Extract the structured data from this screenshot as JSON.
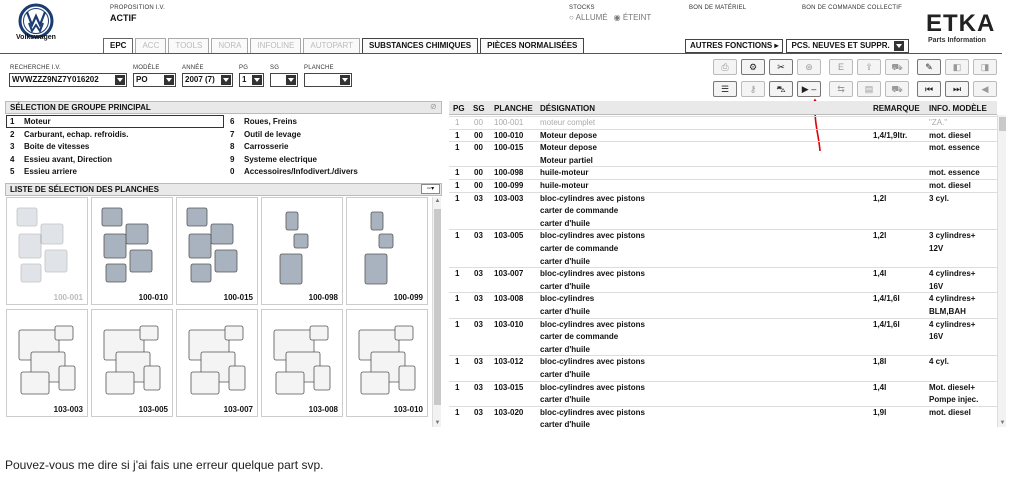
{
  "header": {
    "brand": "Volkswagen",
    "proposition_label": "PROPOSITION I.V.",
    "proposition_value": "ACTIF",
    "stocks_label": "STOCKS",
    "stocks_on": "ALLUMÉ",
    "stocks_off": "ÉTEINT",
    "stocks_selected": "ÉTEINT",
    "bom_label": "BON DE MATÉRIEL",
    "order_label": "BON DE COMMANDE COLLECTIF",
    "product": "ETKA",
    "product_sub": "Parts Information"
  },
  "tabs": [
    "EPC",
    "ACC",
    "TOOLS",
    "NORA",
    "INFOLINE",
    "AUTOPART",
    "SUBSTANCES CHIMIQUES",
    "PIÈCES NORMALISÉES"
  ],
  "active_tab": "EPC",
  "other_functions": {
    "label": "AUTRES FONCTIONS",
    "value": "PCS. NEUVES ET SUPPR."
  },
  "search": {
    "vin_label": "RECHERCHE I.V.",
    "vin_value": "WVWZZZ9NZ7Y016202",
    "model_label": "MODÈLE",
    "model_value": "PO",
    "year_label": "ANNÉE",
    "year_value": "2007 (7)",
    "pg_label": "PG",
    "pg_value": "1",
    "sg_label": "SG",
    "sg_value": "",
    "plate_label": "PLANCHE",
    "plate_value": ""
  },
  "group_panel": {
    "title": "SÉLECTION DE GROUPE PRINCIPAL",
    "groups": [
      {
        "num": "1",
        "label": "Moteur"
      },
      {
        "num": "2",
        "label": "Carburant, echap. refroidis."
      },
      {
        "num": "3",
        "label": "Boite de vitesses"
      },
      {
        "num": "4",
        "label": "Essieu avant, Direction"
      },
      {
        "num": "5",
        "label": "Essieu arriere"
      },
      {
        "num": "6",
        "label": "Roues, Freins"
      },
      {
        "num": "7",
        "label": "Outil de levage"
      },
      {
        "num": "8",
        "label": "Carrosserie"
      },
      {
        "num": "9",
        "label": "Systeme electrique"
      },
      {
        "num": "0",
        "label": "Accessoires/Infodivert./divers"
      }
    ],
    "selected": "1"
  },
  "plates_panel": {
    "title": "LISTE DE SÉLECTION DES PLANCHES",
    "plates": [
      "100-001",
      "100-010",
      "100-015",
      "100-098",
      "100-099",
      "103-003",
      "103-005",
      "103-007",
      "103-008",
      "103-010"
    ]
  },
  "table": {
    "headers": {
      "pg": "PG",
      "sg": "SG",
      "plate": "PLANCHE",
      "designation": "DÉSIGNATION",
      "remark": "REMARQUE",
      "model_info": "INFO. MODÈLE"
    },
    "rows": [
      {
        "pg": "1",
        "sg": "00",
        "plate": "100-001",
        "designation": [
          "moteur complet"
        ],
        "remark": "",
        "info": [
          "\"ZA.\""
        ],
        "grey": true
      },
      {
        "pg": "1",
        "sg": "00",
        "plate": "100-010",
        "designation": [
          "Moteur depose"
        ],
        "remark": "1,4/1,9ltr.",
        "info": [
          "mot. diesel"
        ]
      },
      {
        "pg": "1",
        "sg": "00",
        "plate": "100-015",
        "designation": [
          "Moteur depose",
          "Moteur partiel"
        ],
        "remark": "",
        "info": [
          "mot. essence"
        ]
      },
      {
        "pg": "1",
        "sg": "00",
        "plate": "100-098",
        "designation": [
          "huile-moteur"
        ],
        "remark": "",
        "info": [
          "mot. essence"
        ]
      },
      {
        "pg": "1",
        "sg": "00",
        "plate": "100-099",
        "designation": [
          "huile-moteur"
        ],
        "remark": "",
        "info": [
          "mot. diesel"
        ]
      },
      {
        "pg": "1",
        "sg": "03",
        "plate": "103-003",
        "designation": [
          "bloc-cylindres avec pistons",
          "carter de commande",
          "carter d'huile"
        ],
        "remark": "1,2l",
        "info": [
          "3 cyl."
        ]
      },
      {
        "pg": "1",
        "sg": "03",
        "plate": "103-005",
        "designation": [
          "bloc-cylindres avec pistons",
          "carter de commande",
          "carter d'huile"
        ],
        "remark": "1,2l",
        "info": [
          "3 cylindres+",
          "12V"
        ]
      },
      {
        "pg": "1",
        "sg": "03",
        "plate": "103-007",
        "designation": [
          "bloc-cylindres avec pistons",
          "carter d'huile"
        ],
        "remark": "1,4l",
        "info": [
          "4 cylindres+",
          "16V"
        ]
      },
      {
        "pg": "1",
        "sg": "03",
        "plate": "103-008",
        "designation": [
          "bloc-cylindres",
          "carter d'huile"
        ],
        "remark": "1,4/1,6l",
        "info": [
          "4 cylindres+",
          "BLM,BAH"
        ]
      },
      {
        "pg": "1",
        "sg": "03",
        "plate": "103-010",
        "designation": [
          "bloc-cylindres avec pistons",
          "carter de commande",
          "carter d'huile"
        ],
        "remark": "1,4/1,6l",
        "info": [
          "4 cylindres+",
          "16V"
        ]
      },
      {
        "pg": "1",
        "sg": "03",
        "plate": "103-012",
        "designation": [
          "bloc-cylindres avec pistons",
          "carter d'huile"
        ],
        "remark": "1,8l",
        "info": [
          "4 cyl."
        ]
      },
      {
        "pg": "1",
        "sg": "03",
        "plate": "103-015",
        "designation": [
          "bloc-cylindres avec pistons",
          "carter d'huile"
        ],
        "remark": "1,4l",
        "info": [
          "Mot. diesel+",
          "Pompe injec."
        ]
      },
      {
        "pg": "1",
        "sg": "03",
        "plate": "103-020",
        "designation": [
          "bloc-cylindres avec pistons",
          "carter d'huile"
        ],
        "remark": "1,9l",
        "info": [
          "mot. diesel"
        ]
      }
    ]
  },
  "annotation_color": "#e00000",
  "comment": "Pouvez-vous me dire si j'ai fais une erreur quelque part svp."
}
